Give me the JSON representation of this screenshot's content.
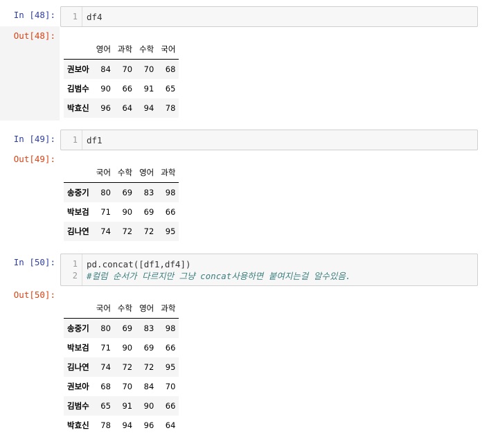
{
  "cells": [
    {
      "in_prompt": "In [48]:",
      "lines": [
        {
          "no": "1",
          "text": "df4"
        }
      ],
      "out_prompt": "Out[48]:",
      "table": {
        "columns": [
          "영어",
          "과학",
          "수학",
          "국어"
        ],
        "rows": [
          {
            "index": "권보아",
            "values": [
              "84",
              "70",
              "70",
              "68"
            ]
          },
          {
            "index": "김범수",
            "values": [
              "90",
              "66",
              "91",
              "65"
            ]
          },
          {
            "index": "박효신",
            "values": [
              "96",
              "64",
              "94",
              "78"
            ]
          }
        ]
      }
    },
    {
      "in_prompt": "In [49]:",
      "lines": [
        {
          "no": "1",
          "text": "df1"
        }
      ],
      "out_prompt": "Out[49]:",
      "table": {
        "columns": [
          "국어",
          "수학",
          "영어",
          "과학"
        ],
        "rows": [
          {
            "index": "송중기",
            "values": [
              "80",
              "69",
              "83",
              "98"
            ]
          },
          {
            "index": "박보검",
            "values": [
              "71",
              "90",
              "69",
              "66"
            ]
          },
          {
            "index": "김나연",
            "values": [
              "74",
              "72",
              "72",
              "95"
            ]
          }
        ]
      }
    },
    {
      "in_prompt": "In [50]:",
      "lines": [
        {
          "no": "1",
          "text": "pd.concat([df1,df4])"
        },
        {
          "no": "2",
          "text": "#컬럼 순서가 다르지만 그냥 concat사용하면 붙여지는걸 알수있음."
        }
      ],
      "out_prompt": "Out[50]:",
      "table": {
        "columns": [
          "국어",
          "수학",
          "영어",
          "과학"
        ],
        "rows": [
          {
            "index": "송중기",
            "values": [
              "80",
              "69",
              "83",
              "98"
            ]
          },
          {
            "index": "박보검",
            "values": [
              "71",
              "90",
              "69",
              "66"
            ]
          },
          {
            "index": "김나연",
            "values": [
              "74",
              "72",
              "72",
              "95"
            ]
          },
          {
            "index": "권보아",
            "values": [
              "68",
              "70",
              "84",
              "70"
            ]
          },
          {
            "index": "김범수",
            "values": [
              "65",
              "91",
              "90",
              "66"
            ]
          },
          {
            "index": "박효신",
            "values": [
              "78",
              "94",
              "96",
              "64"
            ]
          }
        ]
      }
    }
  ]
}
